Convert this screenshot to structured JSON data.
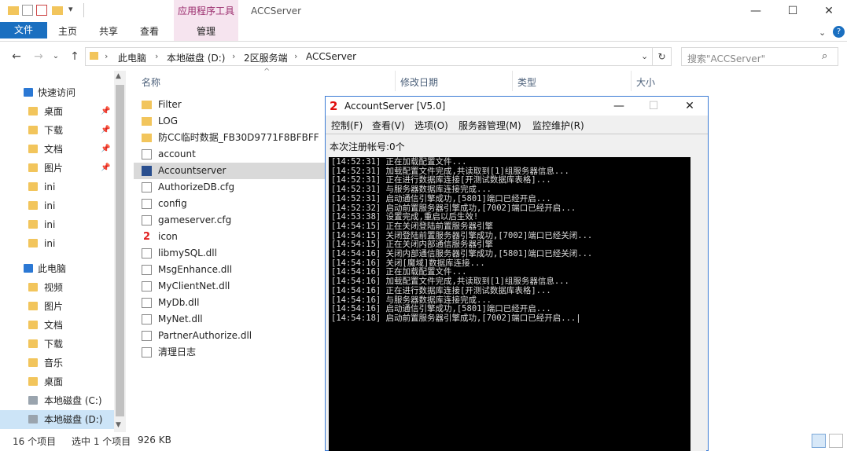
{
  "window": {
    "title": "ACCServer",
    "context_tab": "应用程序工具",
    "controls": {
      "minimize": "—",
      "maximize": "☐",
      "close": "✕"
    }
  },
  "ribbon": {
    "tabs": [
      "文件",
      "主页",
      "共享",
      "查看",
      "管理"
    ],
    "help_icon": "?"
  },
  "address": {
    "breadcrumb": [
      "此电脑",
      "本地磁盘 (D:)",
      "2区服务端",
      "ACCServer"
    ],
    "search_placeholder": "搜索\"ACCServer\""
  },
  "nav": {
    "items": [
      {
        "label": "快速访问",
        "icon": "star-icon",
        "pinned": false
      },
      {
        "label": "桌面",
        "icon": "folder-icon",
        "pinned": true
      },
      {
        "label": "下载",
        "icon": "download-folder-icon",
        "pinned": true
      },
      {
        "label": "文档",
        "icon": "document-folder-icon",
        "pinned": true
      },
      {
        "label": "图片",
        "icon": "picture-folder-icon",
        "pinned": true
      },
      {
        "label": "ini",
        "icon": "folder-icon",
        "pinned": false
      },
      {
        "label": "ini",
        "icon": "folder-icon",
        "pinned": false
      },
      {
        "label": "ini",
        "icon": "folder-icon",
        "pinned": false
      },
      {
        "label": "ini",
        "icon": "folder-icon",
        "pinned": false
      },
      {
        "label": "此电脑",
        "icon": "computer-icon",
        "pinned": false
      },
      {
        "label": "视频",
        "icon": "video-folder-icon",
        "pinned": false
      },
      {
        "label": "图片",
        "icon": "picture-folder-icon",
        "pinned": false
      },
      {
        "label": "文档",
        "icon": "document-folder-icon",
        "pinned": false
      },
      {
        "label": "下载",
        "icon": "download-folder-icon",
        "pinned": false
      },
      {
        "label": "音乐",
        "icon": "music-folder-icon",
        "pinned": false
      },
      {
        "label": "桌面",
        "icon": "folder-icon",
        "pinned": false
      },
      {
        "label": "本地磁盘 (C:)",
        "icon": "drive-icon",
        "pinned": false
      },
      {
        "label": "本地磁盘 (D:)",
        "icon": "drive-icon",
        "pinned": false
      }
    ],
    "pin_icon": "📌"
  },
  "columns": {
    "name": "名称",
    "date": "修改日期",
    "type": "类型",
    "size": "大小"
  },
  "files": [
    {
      "name": "Filter",
      "icon": "folder"
    },
    {
      "name": "LOG",
      "icon": "folder"
    },
    {
      "name": "防CC临时数据_FB30D9771F8BFBFF",
      "icon": "folder"
    },
    {
      "name": "account",
      "icon": "doc"
    },
    {
      "name": "Accountserver",
      "icon": "exe"
    },
    {
      "name": "AuthorizeDB.cfg",
      "icon": "doc"
    },
    {
      "name": "config",
      "icon": "doc"
    },
    {
      "name": "gameserver.cfg",
      "icon": "doc"
    },
    {
      "name": "icon",
      "icon": "red"
    },
    {
      "name": "libmySQL.dll",
      "icon": "doc"
    },
    {
      "name": "MsgEnhance.dll",
      "icon": "doc"
    },
    {
      "name": "MyClientNet.dll",
      "icon": "doc"
    },
    {
      "name": "MyDb.dll",
      "icon": "doc"
    },
    {
      "name": "MyNet.dll",
      "icon": "doc"
    },
    {
      "name": "PartnerAuthorize.dll",
      "icon": "doc"
    },
    {
      "name": "清理日志",
      "icon": "doc"
    }
  ],
  "status": {
    "count": "16 个项目",
    "selected": "选中 1 个项目",
    "size": "926 KB"
  },
  "dialog": {
    "icon_glyph": "2",
    "title": "AccountServer [V5.0]",
    "menus": [
      "控制(F)",
      "查看(V)",
      "选项(O)",
      "服务器管理(M)",
      "监控维护(R)"
    ],
    "reg_count": "本次注册帐号:0个",
    "log": [
      "[14:52:31] 正在加载配置文件...",
      "[14:52:31] 加载配置文件完成,共读取到[1]组服务器信息...",
      "[14:52:31] 正在进行数据库连接[开测试数据库表格]...",
      "[14:52:31] 与服务器数据库连接完成...",
      "[14:52:31] 启动通信引擎成功,[5801]端口已经开启...",
      "[14:52:32] 启动前置服务器引擎成功,[7002]端口已经开启...",
      "[14:53:38] 设置完成,重启以后生效!",
      "[14:54:15] 正在关闭登陆前置服务器引擎",
      "[14:54:15] 关闭登陆前置服务器引擎成功,[7002]端口已经关闭...",
      "[14:54:15] 正在关闭内部通信服务器引擎",
      "[14:54:16] 关闭内部通信服务器引擎成功,[5801]端口已经关闭...",
      "[14:54:16] 关闭[魔域]数据库连接...",
      "[14:54:16] 正在加载配置文件...",
      "[14:54:16] 加载配置文件完成,共读取到[1]组服务器信息...",
      "[14:54:16] 正在进行数据库连接[开测试数据库表格]...",
      "[14:54:16] 与服务器数据库连接完成...",
      "[14:54:16] 启动通信引擎成功,[5801]端口已经开启...",
      "[14:54:18] 启动前置服务器引擎成功,[7002]端口已经开启...|"
    ]
  }
}
